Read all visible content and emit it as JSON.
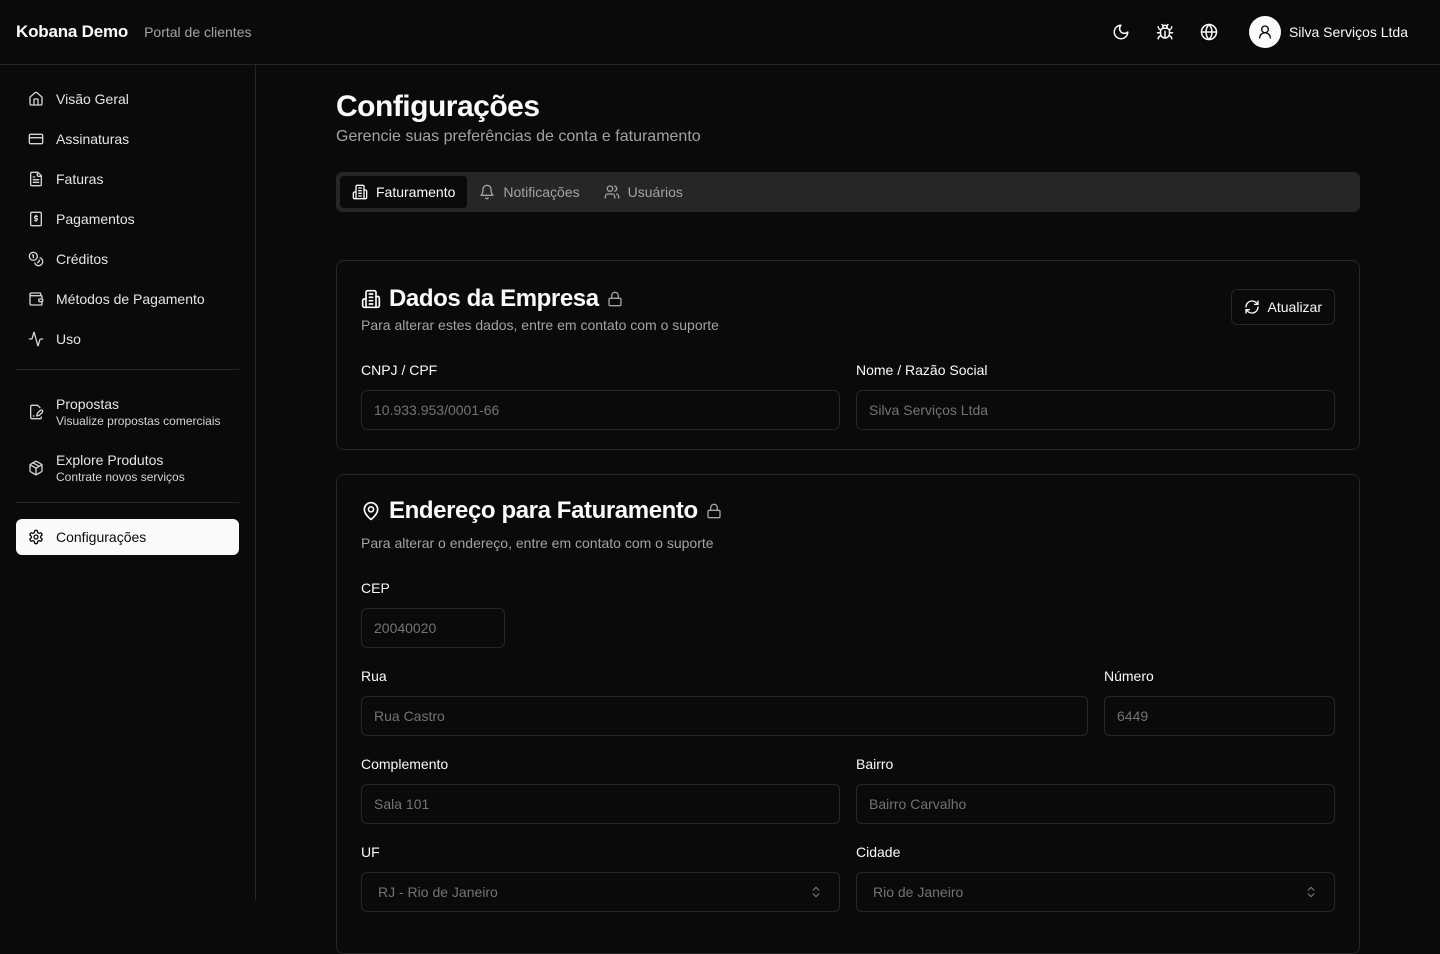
{
  "header": {
    "brand": "Kobana Demo",
    "subtitle": "Portal de clientes",
    "theme_icon": "moon-icon",
    "debug_icon": "bug-icon",
    "language_icon": "globe-icon",
    "user_name": "Silva Serviços Ltda"
  },
  "sidebar": {
    "items": [
      {
        "label": "Visão Geral",
        "icon": "home-icon"
      },
      {
        "label": "Assinaturas",
        "icon": "credit-card-icon"
      },
      {
        "label": "Faturas",
        "icon": "file-text-icon"
      },
      {
        "label": "Pagamentos",
        "icon": "receipt-dollar-icon"
      },
      {
        "label": "Créditos",
        "icon": "coins-icon"
      },
      {
        "label": "Métodos de Pagamento",
        "icon": "wallet-icon"
      },
      {
        "label": "Uso",
        "icon": "activity-icon"
      }
    ],
    "secondary": [
      {
        "label": "Propostas",
        "sub": "Visualize propostas comerciais",
        "icon": "file-signature-icon"
      },
      {
        "label": "Explore Produtos",
        "sub": "Contrate novos serviços",
        "icon": "package-icon"
      }
    ],
    "settings": {
      "label": "Configurações",
      "icon": "settings-icon",
      "active": true
    }
  },
  "page": {
    "title": "Configurações",
    "subtitle": "Gerencie suas preferências de conta e faturamento"
  },
  "tabs": [
    {
      "label": "Faturamento",
      "icon": "building-icon",
      "active": true
    },
    {
      "label": "Notificações",
      "icon": "bell-icon",
      "active": false
    },
    {
      "label": "Usuários",
      "icon": "users-icon",
      "active": false
    }
  ],
  "company": {
    "title": "Dados da Empresa",
    "description": "Para alterar estes dados, entre em contato com o suporte",
    "refresh_label": "Atualizar",
    "cnpj_label": "CNPJ / CPF",
    "cnpj_value": "10.933.953/0001-66",
    "name_label": "Nome / Razão Social",
    "name_value": "Silva Serviços Ltda"
  },
  "address": {
    "title": "Endereço para Faturamento",
    "description": "Para alterar o endereço, entre em contato com o suporte",
    "cep_label": "CEP",
    "cep_value": "20040020",
    "street_label": "Rua",
    "street_value": "Rua Castro",
    "number_label": "Número",
    "number_value": "6449",
    "complement_label": "Complemento",
    "complement_placeholder": "Sala 101",
    "district_label": "Bairro",
    "district_value": "Bairro Carvalho",
    "uf_label": "UF",
    "uf_value": "RJ - Rio de Janeiro",
    "city_label": "Cidade",
    "city_value": "Rio de Janeiro"
  }
}
